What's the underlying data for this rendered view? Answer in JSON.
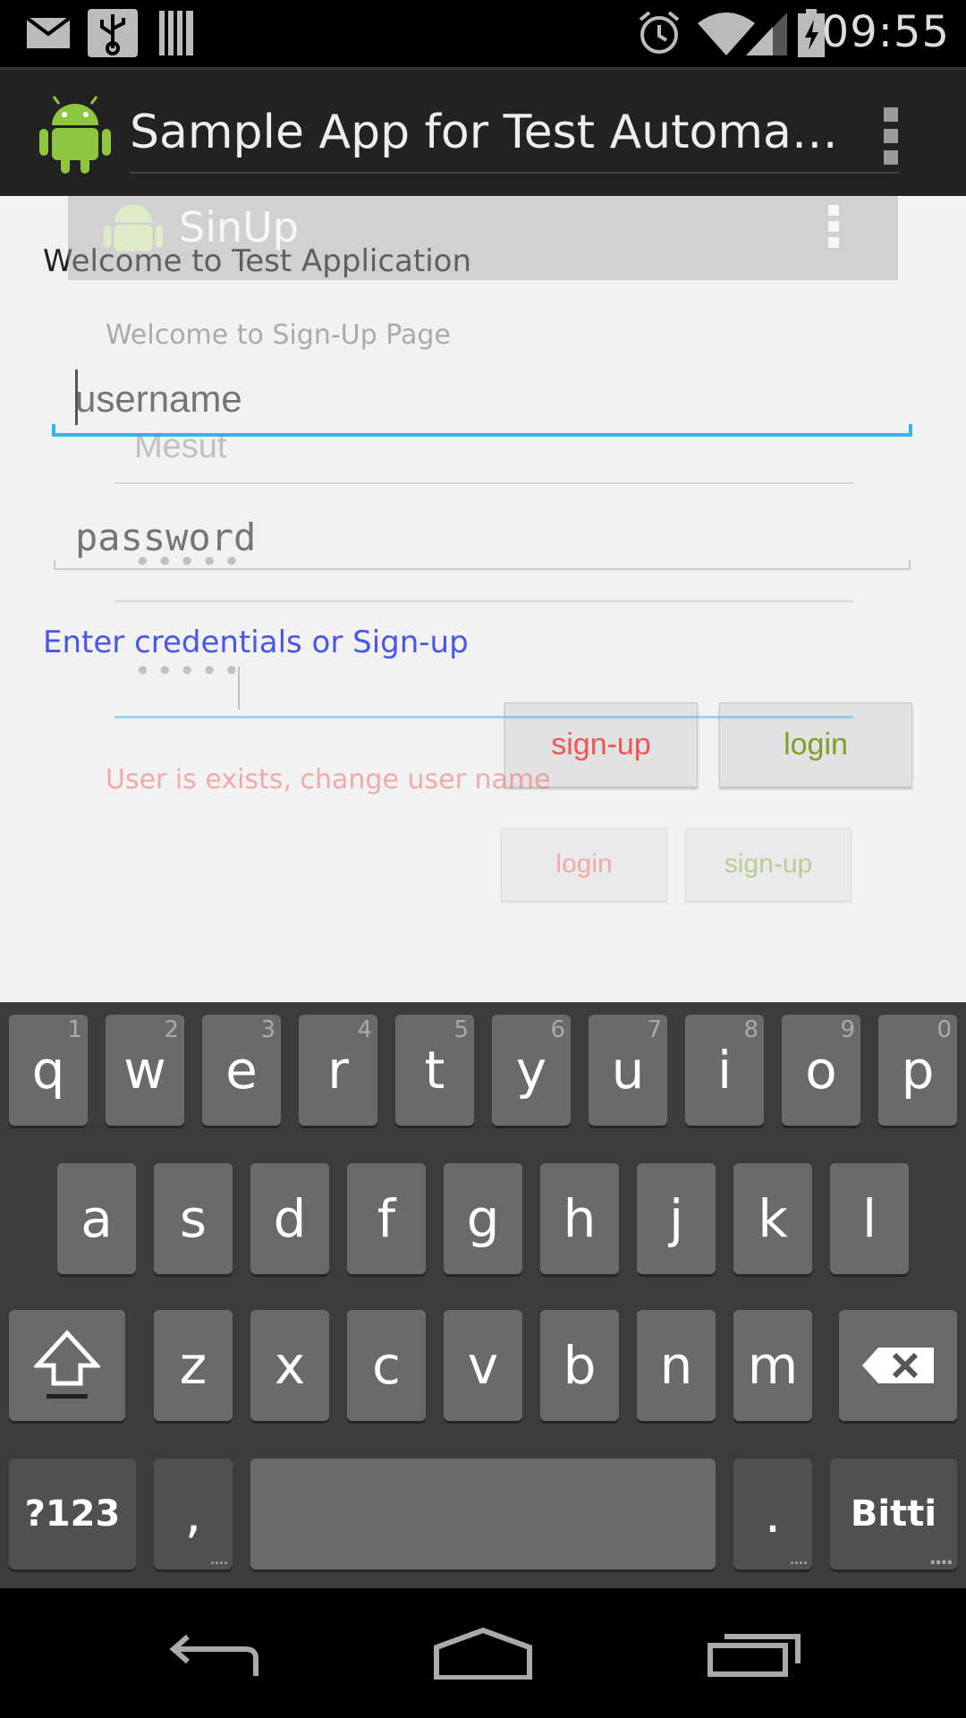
{
  "status_bar": {
    "time": "09:55",
    "icons": [
      "mail-icon",
      "usb-icon",
      "barcode-icon",
      "alarm-icon",
      "wifi-icon",
      "signal-icon",
      "battery-charging-icon"
    ]
  },
  "action_bar": {
    "title": "Sample App for Test Automa…",
    "icon": "android-icon",
    "menu_icon": "overflow-menu-icon"
  },
  "login_page": {
    "welcome": "Welcome to Test Application",
    "username_placeholder": "username",
    "password_placeholder": "password",
    "instructions": "Enter credentials or Sign-up",
    "signup_label": "sign-up",
    "login_label": "login"
  },
  "signup_dialog": {
    "title": "SinUp",
    "welcome": "Welcome to Sign-Up Page",
    "username_value": "Mesut",
    "password_value": "•••••",
    "confirm_value": "•••••",
    "error": "User is exists, change user name",
    "login_label": "login",
    "signup_label": "sign-up"
  },
  "keyboard": {
    "row1": [
      {
        "k": "q",
        "h": "1"
      },
      {
        "k": "w",
        "h": "2"
      },
      {
        "k": "e",
        "h": "3"
      },
      {
        "k": "r",
        "h": "4"
      },
      {
        "k": "t",
        "h": "5"
      },
      {
        "k": "y",
        "h": "6"
      },
      {
        "k": "u",
        "h": "7"
      },
      {
        "k": "i",
        "h": "8"
      },
      {
        "k": "o",
        "h": "9"
      },
      {
        "k": "p",
        "h": "0"
      }
    ],
    "row2": [
      "a",
      "s",
      "d",
      "f",
      "g",
      "h",
      "j",
      "k",
      "l"
    ],
    "row3": [
      "z",
      "x",
      "c",
      "v",
      "b",
      "n",
      "m"
    ],
    "symbols_label": "?123",
    "comma_label": ",",
    "period_label": ".",
    "done_label": "Bitti",
    "more_dots": "...."
  },
  "nav_bar": {
    "icons": [
      "back-icon",
      "home-icon",
      "recent-apps-icon"
    ]
  },
  "colors": {
    "accent": "#33b5e5",
    "link": "#4a55ea",
    "error": "#f05555",
    "positive": "#7aa12a"
  }
}
